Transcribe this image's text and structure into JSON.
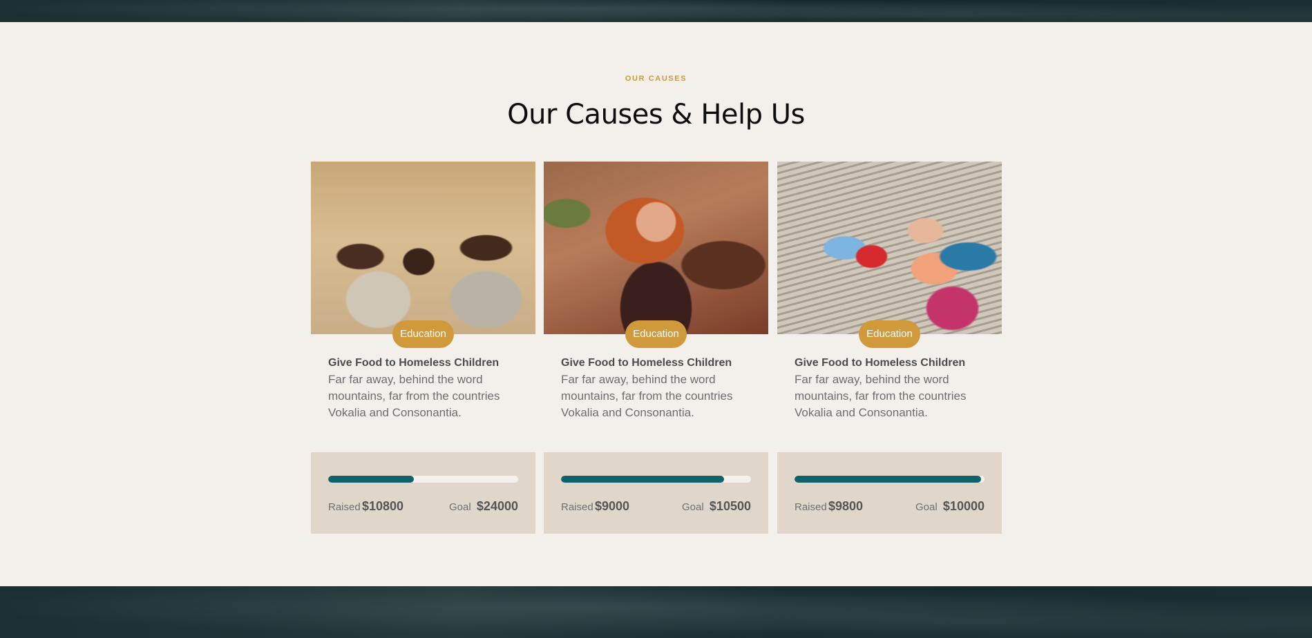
{
  "section": {
    "eyebrow": "OUR CAUSES",
    "title": "Our Causes & Help Us"
  },
  "colors": {
    "accent": "#d09a3c",
    "progress": "#10626a",
    "background": "#f3f0ec",
    "stats_panel": "#e0d7ca"
  },
  "causes": [
    {
      "category": "Education",
      "title": "Give Food to Homeless Children",
      "description": "Far far away, behind the word mountains, far from the countries Vokalia and Consonantia.",
      "raised_label": "Raised",
      "raised": "$10800",
      "goal_label": "Goal",
      "goal": "$24000",
      "progress": 0.45
    },
    {
      "category": "Education",
      "title": "Give Food to Homeless Children",
      "description": "Far far away, behind the word mountains, far from the countries Vokalia and Consonantia.",
      "raised_label": "Raised",
      "raised": "$9000",
      "goal_label": "Goal",
      "goal": "$10500",
      "progress": 0.857
    },
    {
      "category": "Education",
      "title": "Give Food to Homeless Children",
      "description": "Far far away, behind the word mountains, far from the countries Vokalia and Consonantia.",
      "raised_label": "Raised",
      "raised": "$9800",
      "goal_label": "Goal",
      "goal": "$10000",
      "progress": 0.98
    }
  ]
}
